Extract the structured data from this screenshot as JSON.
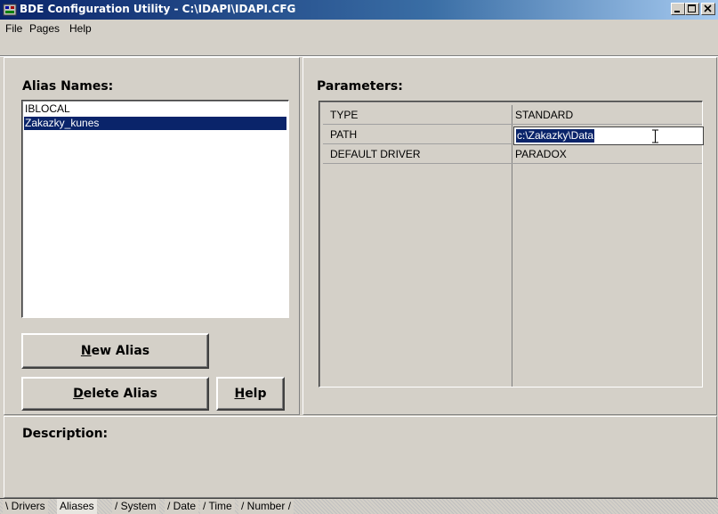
{
  "window": {
    "title": "BDE Configuration Utility - C:\\IDAPI\\IDAPI.CFG",
    "controls": {
      "minimize": "_",
      "maximize": "□",
      "close": "✕"
    }
  },
  "menu": [
    "File",
    "Pages",
    "Help"
  ],
  "alias_panel": {
    "header": "Alias Names:",
    "items": [
      "IBLOCAL",
      "Zakazky_kunes"
    ],
    "selected": "Zakazky_kunes",
    "buttons": {
      "new_alias": {
        "mnemonic": "N",
        "rest": "ew Alias"
      },
      "delete_alias": {
        "mnemonic": "D",
        "rest": "elete Alias"
      },
      "help": {
        "mnemonic": "H",
        "rest": "elp"
      }
    }
  },
  "parameters": {
    "header": "Parameters:",
    "rows": [
      {
        "key": "TYPE",
        "value": "STANDARD"
      },
      {
        "key": "PATH",
        "value": "c:\\Zakazky\\Data"
      },
      {
        "key": "DEFAULT DRIVER",
        "value": "PARADOX"
      }
    ]
  },
  "description": {
    "header": "Description:"
  },
  "tabs": [
    "Drivers",
    "Aliases",
    "System",
    "Date",
    "Time",
    "Number"
  ],
  "active_tab": "Aliases",
  "colors": {
    "title_start": "#0a246a",
    "title_end": "#a6caf0",
    "selection": "#0a246a",
    "face": "#d4d0c8"
  },
  "icons": [
    "bde-app-icon",
    "text-cursor-ibeam-icon"
  ]
}
